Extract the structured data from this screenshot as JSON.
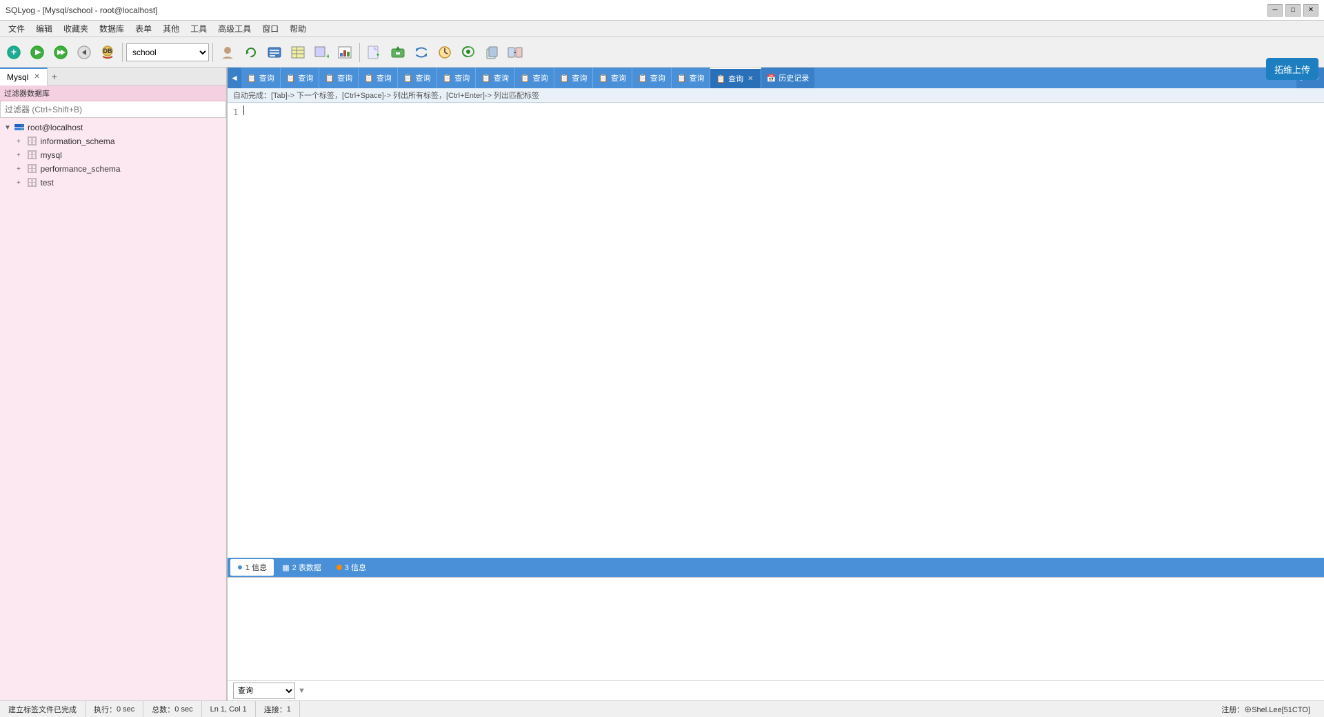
{
  "titlebar": {
    "title": "SQLyog - [Mysql/school - root@localhost]",
    "minimize": "─",
    "maximize": "□",
    "close": "✕"
  },
  "menubar": {
    "items": [
      "文件",
      "编辑",
      "收藏夹",
      "数据库",
      "表单",
      "其他",
      "工具",
      "高级工具",
      "窗口",
      "帮助"
    ]
  },
  "toolbar": {
    "db_value": "school",
    "upload_btn": "拓维上传"
  },
  "sidebar": {
    "tab_label": "Mysql",
    "filter_label": "过滤器数据库",
    "filter_placeholder": "过滤器 (Ctrl+Shift+B)",
    "host": "root@localhost",
    "databases": [
      {
        "name": "information_schema"
      },
      {
        "name": "mysql"
      },
      {
        "name": "performance_schema"
      },
      {
        "name": "test"
      }
    ]
  },
  "query_tabs": {
    "prev_icon": "◄",
    "next_icon": "►",
    "tabs": [
      {
        "label": "查询",
        "active": false
      },
      {
        "label": "查询",
        "active": false
      },
      {
        "label": "查询",
        "active": false
      },
      {
        "label": "查询",
        "active": false
      },
      {
        "label": "查询",
        "active": false
      },
      {
        "label": "查询",
        "active": false
      },
      {
        "label": "查询",
        "active": false
      },
      {
        "label": "查询",
        "active": false
      },
      {
        "label": "查询",
        "active": false
      },
      {
        "label": "查询",
        "active": false
      },
      {
        "label": "查询",
        "active": false
      },
      {
        "label": "查询",
        "active": false
      },
      {
        "label": "查询",
        "active": true
      },
      {
        "label": "历史记录",
        "active": false,
        "is_history": true
      }
    ]
  },
  "autocomplete_hint": "自动完成：[Tab]-> 下一个标签，[Ctrl+Space]-> 列出所有标签，[Ctrl+Enter]-> 列出匹配标签",
  "editor": {
    "line": "1"
  },
  "bottom_tabs": [
    {
      "label": "1 信息",
      "type": "info",
      "active": true
    },
    {
      "label": "2 表数据",
      "type": "table",
      "active": false
    },
    {
      "label": "3 信息",
      "type": "warn",
      "active": false
    }
  ],
  "query_type": {
    "options": [
      "查询"
    ],
    "selected": "查询"
  },
  "statusbar": {
    "status_msg": "建立标签文件已完成",
    "exec_label": "执行：",
    "exec_value": "0 sec",
    "total_label": "总数：",
    "total_value": "0 sec",
    "position": "Ln 1, Col 1",
    "connection": "连接：",
    "connection_value": "1",
    "note": "注册：⊕Shel.Lee[51CTO]"
  }
}
